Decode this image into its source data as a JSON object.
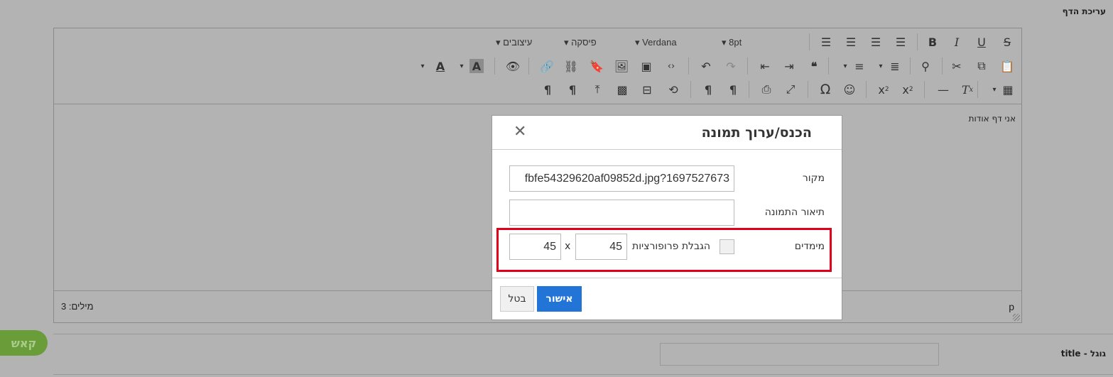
{
  "page": {
    "section_label": "עריכת הדף",
    "google_title_label": "title - גוגל",
    "save_label": "קאש"
  },
  "toolbar": {
    "formats_label": "עיצובים",
    "paragraph_label": "פיסקה",
    "font_label": "Verdana",
    "size_label": "8pt",
    "text_color_glyph": "A",
    "bg_color_glyph": "A",
    "omega_glyph": "Ω"
  },
  "editor": {
    "content": "אני דף אודות",
    "word_count": "מילים: 3",
    "path": "p"
  },
  "modal": {
    "title": "הכנס/ערוך תמונה",
    "close_glyph": "✕",
    "source_label": "מקור",
    "source_value": "fbfe54329620af09852d.jpg?1697527673",
    "description_label": "תיאור התמונה",
    "description_value": "",
    "dimensions_label": "מימדים",
    "width_value": "45",
    "height_value": "45",
    "times_glyph": "x",
    "constrain_label": "הגבלת פרופורציות",
    "ok_label": "אישור",
    "cancel_label": "בטל"
  }
}
